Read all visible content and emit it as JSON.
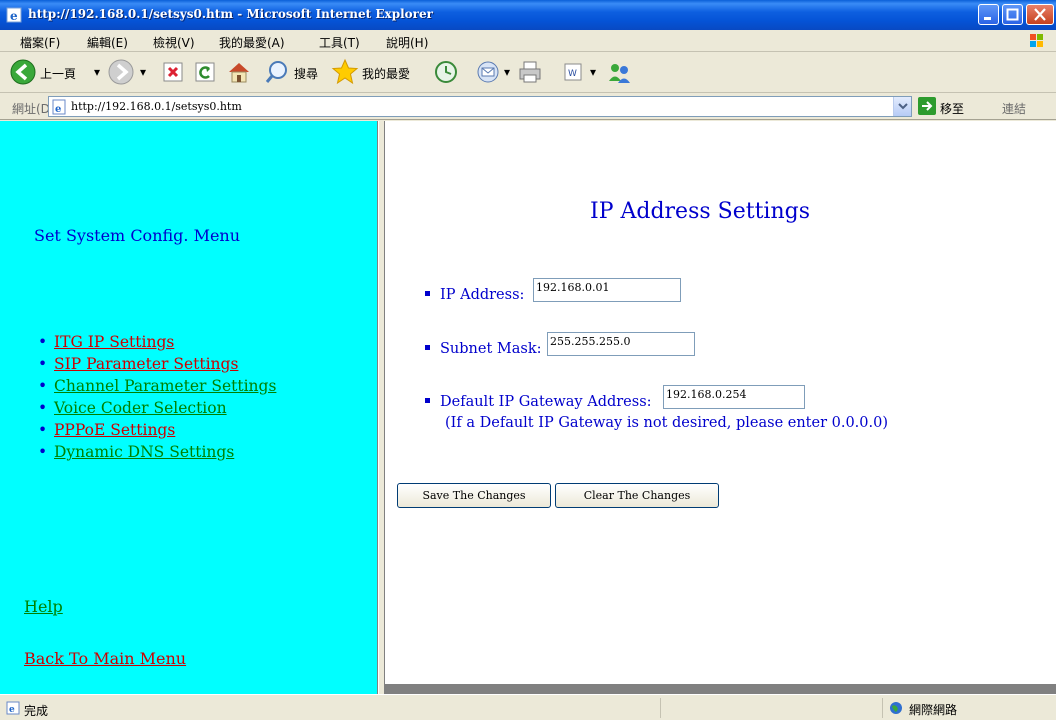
{
  "window": {
    "title": "http://192.168.0.1/setsys0.htm - Microsoft Internet Explorer"
  },
  "menubar": {
    "items": [
      "檔案(F)",
      "編輯(E)",
      "檢視(V)",
      "我的最愛(A)",
      "工具(T)",
      "說明(H)"
    ]
  },
  "toolbar": {
    "back_label": "上一頁",
    "search_label": "搜尋",
    "favorites_label": "我的最愛"
  },
  "address": {
    "label": "網址(D)",
    "url": "http://192.168.0.1/setsys0.htm",
    "go_label": "移至",
    "links_label": "連結"
  },
  "sidebar": {
    "title": "Set System Config. Menu",
    "items": [
      {
        "label": "ITG IP Settings",
        "color": "#cc0000"
      },
      {
        "label": "SIP Parameter Settings",
        "color": "#cc0000"
      },
      {
        "label": "Channel Parameter Settings",
        "color": "#008000"
      },
      {
        "label": "Voice Coder Selection",
        "color": "#008000"
      },
      {
        "label": "PPPoE Settings",
        "color": "#cc0000"
      },
      {
        "label": "Dynamic DNS Settings",
        "color": "#008000"
      }
    ],
    "help": "Help",
    "back": "Back To Main Menu"
  },
  "main": {
    "title": "IP Address Settings",
    "ip_label": "IP Address:",
    "ip_value": "192.168.0.01",
    "mask_label": "Subnet Mask:",
    "mask_value": "255.255.255.0",
    "gateway_label": "Default IP Gateway Address:",
    "gateway_value": "192.168.0.254",
    "gateway_note": "(If a Default IP Gateway is not desired, please enter 0.0.0.0)",
    "save_label": "Save The Changes",
    "clear_label": "Clear The Changes"
  },
  "statusbar": {
    "status": "完成",
    "zone": "網際網路"
  },
  "colors": {
    "sidebar_bg": "#00ffff",
    "text_blue": "#0000cc",
    "link_red": "#cc0000",
    "link_green": "#008000"
  }
}
